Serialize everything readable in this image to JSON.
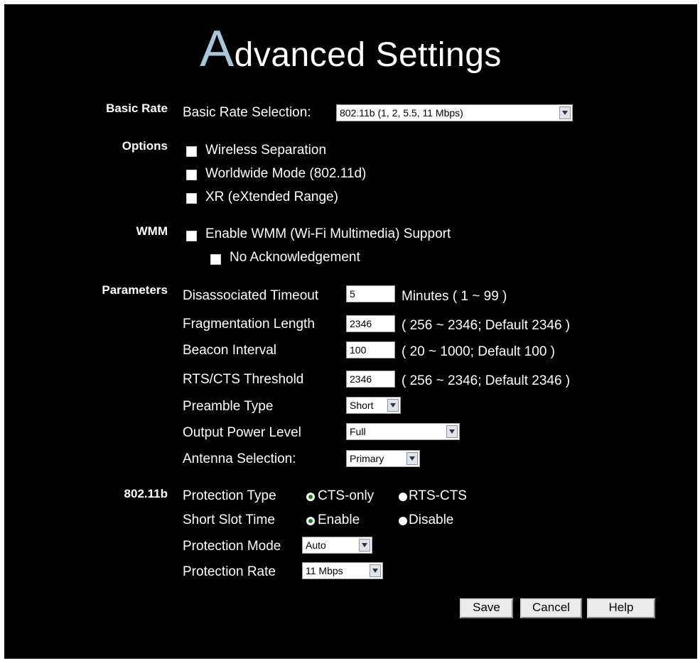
{
  "title": {
    "first_letter": "A",
    "rest": "dvanced Settings"
  },
  "basic_rate": {
    "section": "Basic Rate",
    "label": "Basic Rate Selection:",
    "selected": "802.11b (1, 2, 5.5, 11 Mbps)"
  },
  "options": {
    "section": "Options",
    "items": [
      "Wireless Separation",
      "Worldwide Mode (802.11d)",
      "XR (eXtended Range)"
    ]
  },
  "wmm": {
    "section": "WMM",
    "enable_label": "Enable WMM (Wi-Fi Multimedia) Support",
    "no_ack_label": "No Acknowledgement"
  },
  "parameters": {
    "section": "Parameters",
    "disassoc": {
      "label": "Disassociated Timeout",
      "value": "5",
      "hint": "Minutes ( 1 ~ 99 )"
    },
    "frag": {
      "label": "Fragmentation Length",
      "value": "2346",
      "hint": "( 256 ~ 2346; Default 2346 )"
    },
    "beacon": {
      "label": "Beacon Interval",
      "value": "100",
      "hint": "( 20 ~ 1000; Default 100 )"
    },
    "rts": {
      "label": "RTS/CTS Threshold",
      "value": "2346",
      "hint": "( 256 ~ 2346; Default 2346 )"
    },
    "preamble": {
      "label": "Preamble Type",
      "selected": "Short"
    },
    "power": {
      "label": "Output Power Level",
      "selected": "Full"
    },
    "antenna": {
      "label": "Antenna Selection:",
      "selected": "Primary"
    }
  },
  "b80211": {
    "section": "802.11b",
    "protection_type": {
      "label": "Protection Type",
      "option1": "CTS-only",
      "option2": "RTS-CTS"
    },
    "slot_time": {
      "label": "Short Slot Time",
      "option1": "Enable",
      "option2": "Disable"
    },
    "protection_mode": {
      "label": "Protection Mode",
      "selected": "Auto"
    },
    "protection_rate": {
      "label": "Protection Rate",
      "selected": "11 Mbps"
    }
  },
  "buttons": {
    "save": "Save",
    "cancel": "Cancel",
    "help": "Help"
  },
  "colors": {
    "background": "#000000",
    "title_accent": "#a8c6d8",
    "text": "#ffffff",
    "radio_selected": "#1a7d1a"
  }
}
